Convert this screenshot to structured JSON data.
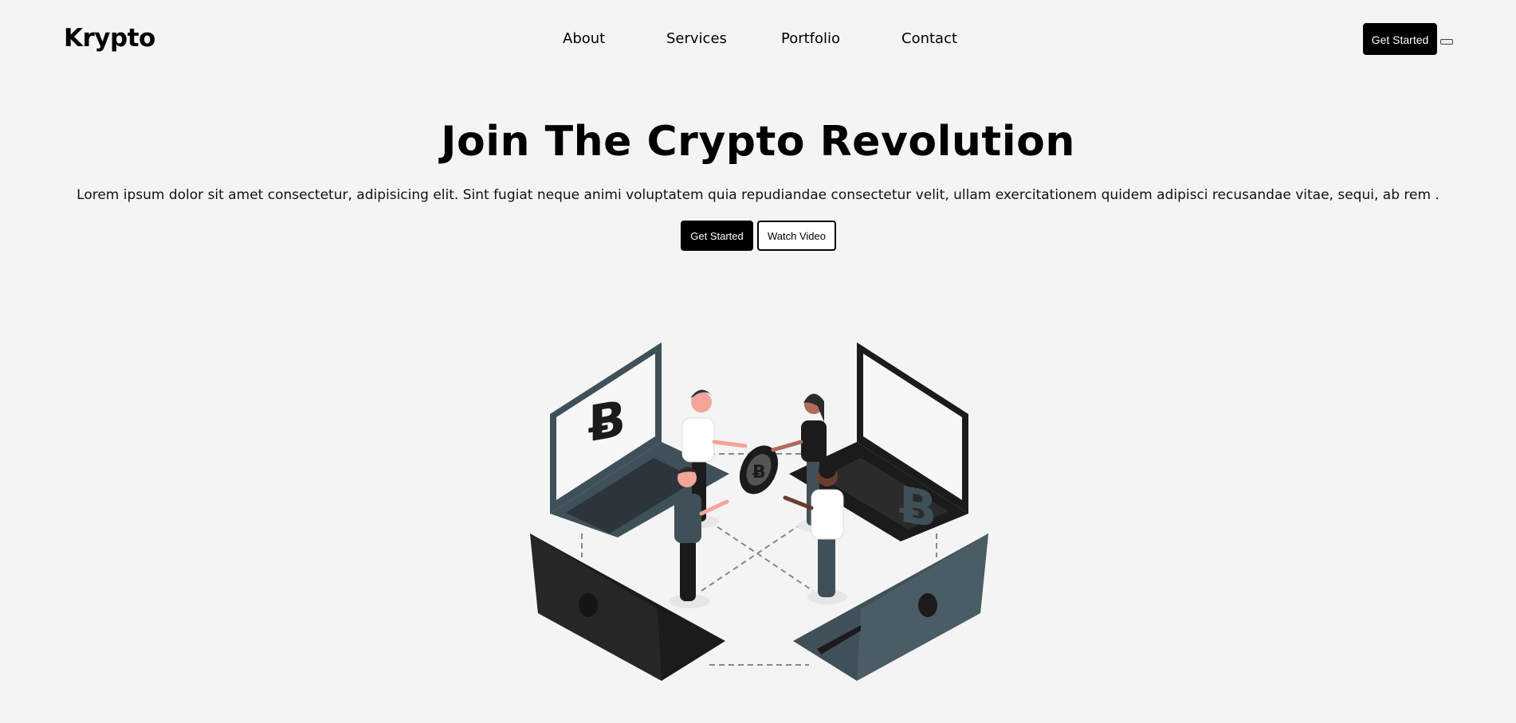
{
  "header": {
    "logo": "Krypto",
    "nav": [
      {
        "label": "About"
      },
      {
        "label": "Services"
      },
      {
        "label": "Portfolio"
      },
      {
        "label": "Contact"
      }
    ],
    "cta_label": "Get Started"
  },
  "hero": {
    "title": "Join The Crypto Revolution",
    "description": "Lorem ipsum dolor sit amet consectetur, adipisicing elit. Sint fugiat neque animi voluptatem quia repudiandae consectetur velit, ullam exercitationem quidem adipisci recusandae vitae, sequi, ab rem .",
    "primary_label": "Get Started",
    "secondary_label": "Watch Video",
    "illustration": {
      "icon": "bitcoin-symbol",
      "colors": {
        "slate": "#3f5059",
        "black": "#1b1b1b",
        "skin": "#f3a59a",
        "white": "#ffffff"
      }
    }
  }
}
